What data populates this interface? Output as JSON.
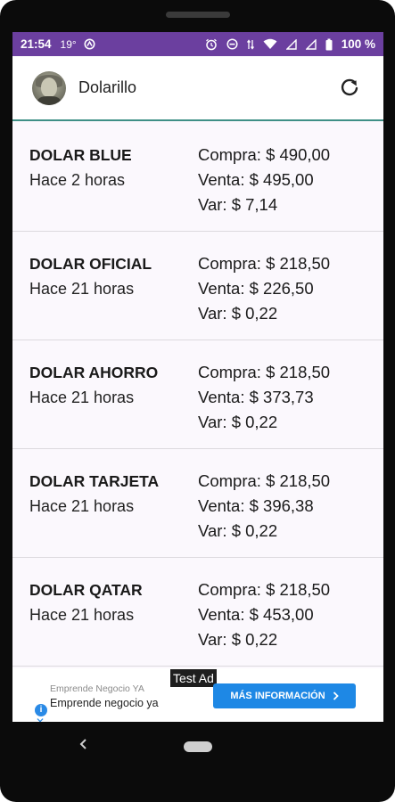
{
  "status_bar": {
    "time": "21:54",
    "temperature": "19°",
    "battery_percent": "100 %",
    "icons": [
      "app-notification-icon",
      "alarm-icon",
      "do-not-disturb-icon",
      "data-arrows-icon",
      "wifi-icon",
      "signal-icon",
      "signal-icon",
      "battery-icon"
    ]
  },
  "app_bar": {
    "title": "Dolarillo",
    "avatar_icon": "franklin-portrait-avatar",
    "refresh_icon": "refresh-icon"
  },
  "rates": [
    {
      "name": "DOLAR BLUE",
      "updated": "Hace 2 horas",
      "buy": "Compra: $ 490,00",
      "sell": "Venta: $ 495,00",
      "var": "Var: $ 7,14"
    },
    {
      "name": "DOLAR OFICIAL",
      "updated": "Hace 21 horas",
      "buy": "Compra: $ 218,50",
      "sell": "Venta: $ 226,50",
      "var": "Var: $ 0,22"
    },
    {
      "name": "DOLAR AHORRO",
      "updated": "Hace 21 horas",
      "buy": "Compra: $ 218,50",
      "sell": "Venta: $ 373,73",
      "var": "Var: $ 0,22"
    },
    {
      "name": "DOLAR TARJETA",
      "updated": "Hace 21 horas",
      "buy": "Compra: $ 218,50",
      "sell": "Venta: $ 396,38",
      "var": "Var: $ 0,22"
    },
    {
      "name": "DOLAR QATAR",
      "updated": "Hace 21 horas",
      "buy": "Compra: $ 218,50",
      "sell": "Venta: $ 453,00",
      "var": "Var: $ 0,22"
    }
  ],
  "ad": {
    "label": "Test Ad",
    "advertiser": "Emprende Negocio YA",
    "headline": "Emprende negocio ya",
    "cta": "MÁS INFORMACIÓN",
    "info_icon": "info-icon",
    "close_icon": "close-icon"
  },
  "colors": {
    "status_bar": "#6b3f9f",
    "app_bar_border": "#3f8f86",
    "cta_button": "#1e88e5"
  }
}
